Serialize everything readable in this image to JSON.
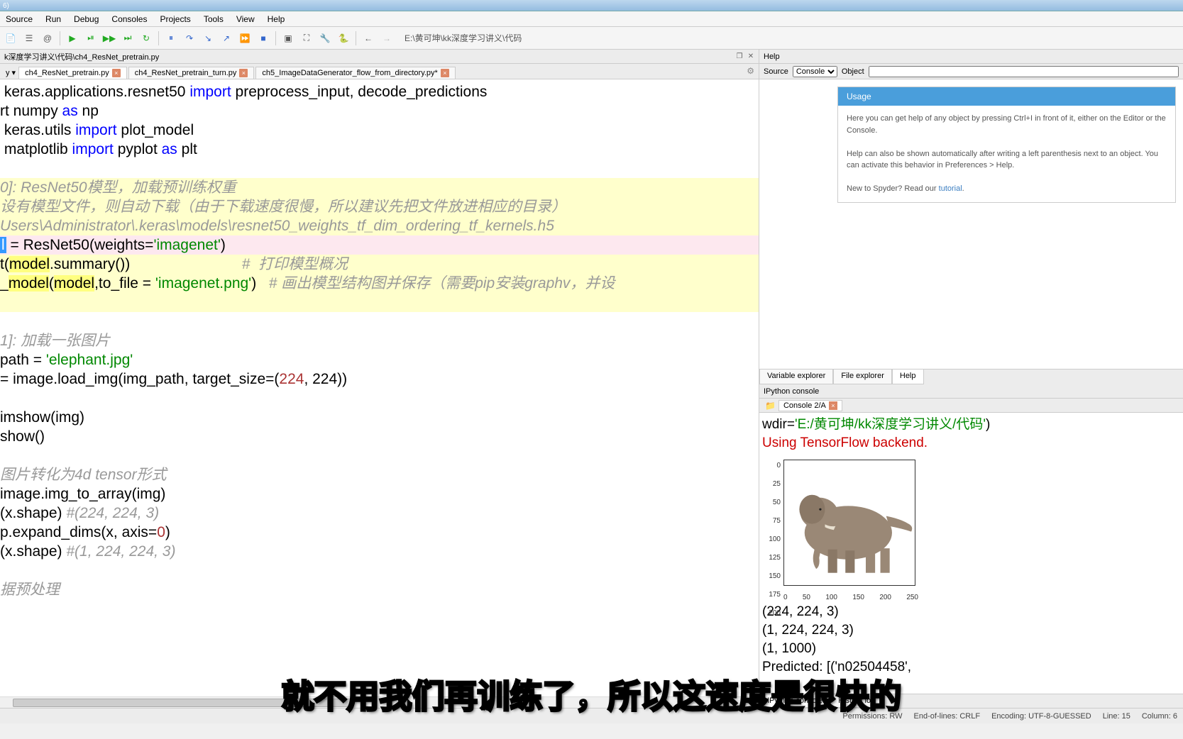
{
  "window_title_suffix": "6)",
  "menu": [
    "Source",
    "Run",
    "Debug",
    "Consoles",
    "Projects",
    "Tools",
    "View",
    "Help"
  ],
  "address_bar": "E:\\黄可坤\\kk深度学习讲义\\代码",
  "breadcrumb": "k深度学习讲义\\代码\\ch4_ResNet_pretrain.py",
  "editor_tabs": [
    {
      "label": "ch4_ResNet_pretrain.py",
      "active": true
    },
    {
      "label": "ch4_ResNet_pretrain_turn.py",
      "active": false
    },
    {
      "label": "ch5_ImageDataGenerator_flow_from_directory.py*",
      "active": false
    }
  ],
  "code_lines": [
    {
      "t": " keras.applications.resnet50 import preprocess_input, decode_predictions",
      "hl": false,
      "kw_at": [
        "import"
      ]
    },
    {
      "t": "rt numpy as np",
      "hl": false,
      "kw_at": [
        "as"
      ]
    },
    {
      "t": " keras.utils import plot_model",
      "hl": false,
      "kw_at": [
        "import"
      ]
    },
    {
      "t": " matplotlib import pyplot as plt",
      "hl": false,
      "kw_at": [
        "import",
        "as"
      ]
    },
    {
      "t": "",
      "hl": false
    },
    {
      "t": "0]: ResNet50模型，加载预训练权重",
      "hl": true,
      "cm": true
    },
    {
      "t": "设有模型文件，则自动下载（由于下载速度很慢，所以建议先把文件放进相应的目录）",
      "hl": true,
      "cm": true
    },
    {
      "t": "Users\\Administrator\\.keras\\models\\resnet50_weights_tf_dim_ordering_tf_kernels.h5",
      "hl": true,
      "cm": true
    },
    {
      "t": " = ResNet50(weights='imagenet')",
      "cur": true,
      "sel": "l"
    },
    {
      "t": "t(model.summary())                           #  打印模型概况",
      "hl": true,
      "cm_partial": "#  打印模型概况",
      "hl_words": [
        "model"
      ]
    },
    {
      "t": "_model(model,to_file = 'imagenet.png')   # 画出模型结构图并保存（需要pip安装graphv，并设",
      "hl": true,
      "cm_partial": "# 画出模型结构图并保存（需要pip安装graphv，并设",
      "hl_words": [
        "model"
      ]
    },
    {
      "t": "",
      "hl": true
    },
    {
      "t": "",
      "hl": false
    },
    {
      "t": "1]: 加载一张图片",
      "hl": false,
      "cm": true
    },
    {
      "t": "path = 'elephant.jpg'",
      "hl": false,
      "str": "'elephant.jpg'"
    },
    {
      "t": "= image.load_img(img_path, target_size=(224, 224))",
      "hl": false,
      "nums": [
        "224",
        "224"
      ]
    },
    {
      "t": "",
      "hl": false
    },
    {
      "t": "imshow(img)",
      "hl": false
    },
    {
      "t": "show()",
      "hl": false
    },
    {
      "t": "",
      "hl": false
    },
    {
      "t": "图片转化为4d tensor形式",
      "hl": false,
      "cm": true
    },
    {
      "t": "image.img_to_array(img)",
      "hl": false
    },
    {
      "t": "(x.shape) #(224, 224, 3)",
      "hl": false,
      "cm_partial": "#(224, 224, 3)"
    },
    {
      "t": "p.expand_dims(x, axis=0)",
      "hl": false,
      "nums": [
        "0"
      ]
    },
    {
      "t": "(x.shape) #(1, 224, 224, 3)",
      "hl": false,
      "cm_partial": "#(1, 224, 224, 3)"
    },
    {
      "t": "",
      "hl": false
    },
    {
      "t": "据预处理",
      "hl": false,
      "cm": true
    }
  ],
  "help": {
    "title": "Help",
    "source_label": "Source",
    "source_value": "Console",
    "object_label": "Object",
    "usage_title": "Usage",
    "usage_p1": "Here you can get help of any object by pressing Ctrl+I in front of it, either on the Editor or the Console.",
    "usage_p2": "Help can also be shown automatically after writing a left parenthesis next to an object. You can activate this behavior in Preferences > Help.",
    "usage_p3": "New to Spyder? Read our ",
    "tutorial_link": "tutorial"
  },
  "right_tabs": [
    "Variable explorer",
    "File explorer",
    "Help"
  ],
  "ipython": {
    "title": "IPython console",
    "tab": "Console 2/A",
    "wdir_label": "wdir=",
    "wdir_path": "'E:/黄可坤/kk深度学习讲义/代码'",
    "wdir_close": ")",
    "backend": "Using TensorFlow backend.",
    "shapes": [
      "(224, 224, 3)",
      "(1, 224, 224, 3)",
      "(1, 1000)"
    ],
    "predicted": "Predicted:  [('n02504458',"
  },
  "chart_data": {
    "type": "image_plot",
    "y_ticks": [
      0,
      25,
      50,
      75,
      100,
      125,
      150,
      175,
      200
    ],
    "x_ticks": [
      0,
      50,
      100,
      150,
      200,
      250
    ],
    "description": "matplotlib imshow of elephant.jpg at 224x224"
  },
  "bottom_tabs": [
    "IPython console",
    "History log"
  ],
  "status": {
    "perms": "Permissions: RW",
    "eol": "End-of-lines: CRLF",
    "enc": "Encoding: UTF-8-GUESSED",
    "line": "Line: 15",
    "col": "Column: 6"
  },
  "subtitle": "就不用我们再训练了，所以这速度是很快的"
}
